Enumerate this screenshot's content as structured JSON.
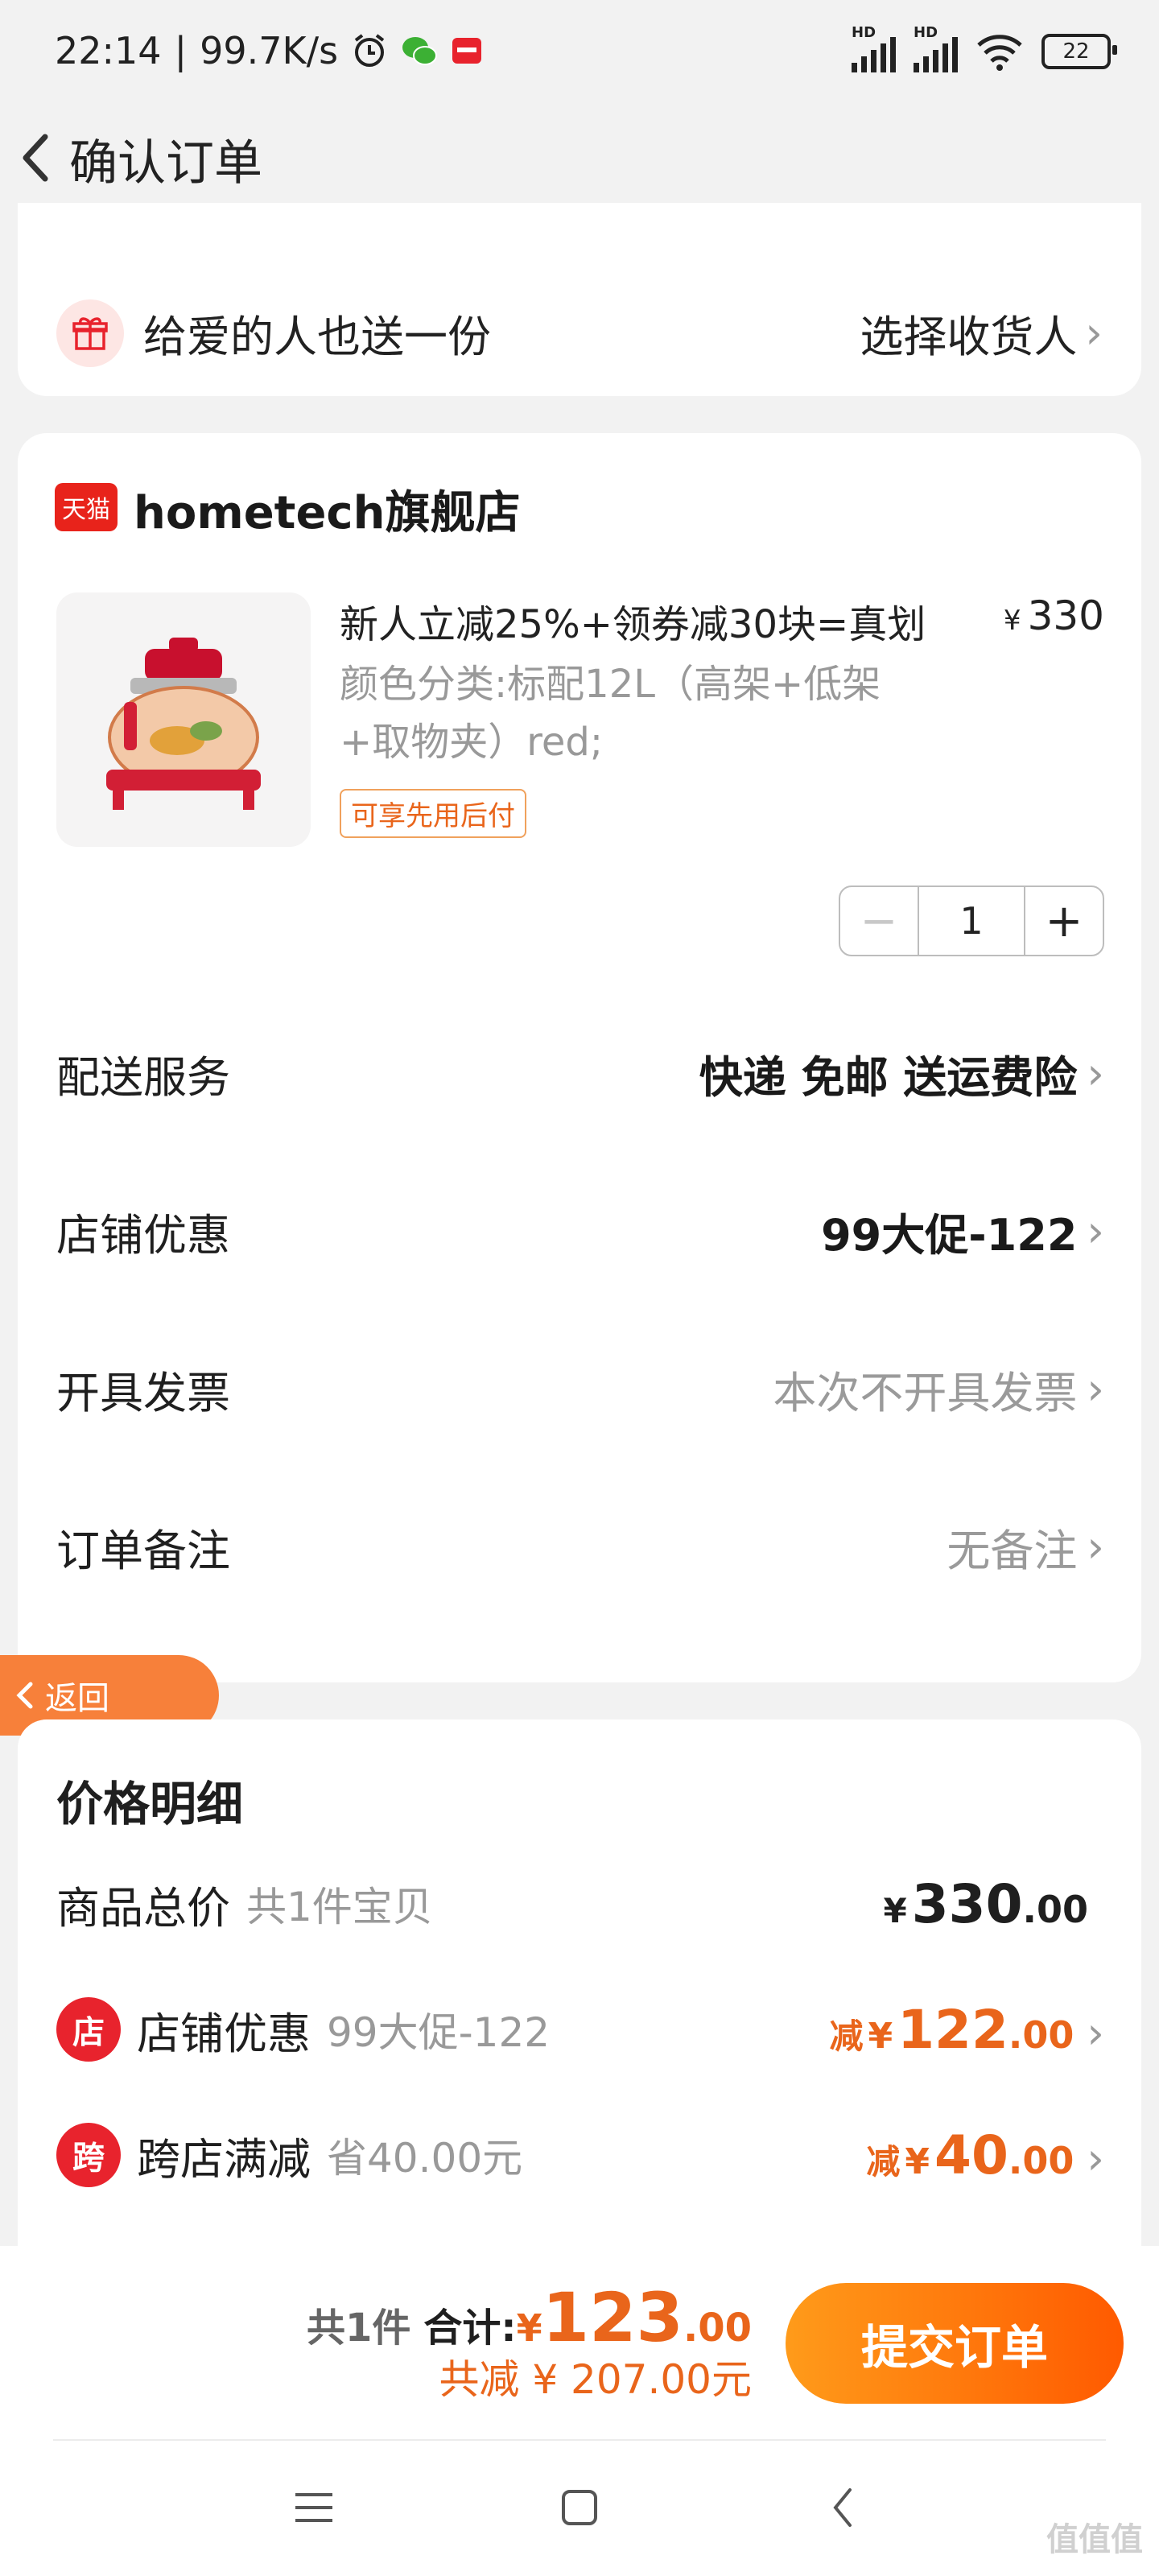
{
  "status": {
    "time": "22:14",
    "speed": "99.7K/s",
    "battery": "22",
    "hd": "HD"
  },
  "header": {
    "title": "确认订单"
  },
  "gift": {
    "label": "给爱的人也送一份",
    "action": "选择收货人"
  },
  "store": {
    "badge": "天猫",
    "name": "hometech旗舰店"
  },
  "product": {
    "title": "新人立减25%+领券减30块=真划",
    "currency": "¥",
    "price": "330",
    "spec": "颜色分类:标配12L（高架+低架+取物夹）red;",
    "tag": "可享先用后付",
    "quantity": "1",
    "minus": "−",
    "plus": "+"
  },
  "rows": [
    {
      "label": "配送服务",
      "value": "快递 免邮 送运费险"
    },
    {
      "label": "店铺优惠",
      "value": "99大促-122"
    },
    {
      "label": "开具发票",
      "value": "本次不开具发票"
    },
    {
      "label": "订单备注",
      "value": "无备注"
    }
  ],
  "fab": {
    "label": "返回"
  },
  "price_detail": {
    "title": "价格明细",
    "total": {
      "label": "商品总价",
      "sub": "共1件宝贝",
      "currency": "¥",
      "int": "330",
      "dec": ".00"
    },
    "store_discount": {
      "icon": "店",
      "label": "店铺优惠",
      "sub": "99大促-122",
      "prefix": "减",
      "currency": "¥",
      "int": "122",
      "dec": ".00"
    },
    "cross_discount": {
      "icon": "跨",
      "label": "跨店满减",
      "sub": "省40.00元",
      "prefix": "减",
      "currency": "¥",
      "int": "40",
      "dec": ".00"
    }
  },
  "bottom": {
    "count": "共1件",
    "total_label": "合计:",
    "currency": "¥",
    "total_int": "123",
    "total_dec": ".00",
    "saved": "共减 ¥ 207.00元",
    "submit": "提交订单"
  },
  "watermark": "值值值",
  "colors": {
    "accent": "#e9651b",
    "brand_red": "#e8231b",
    "submit_start": "#ff9b1a",
    "submit_end": "#ff5a00"
  }
}
